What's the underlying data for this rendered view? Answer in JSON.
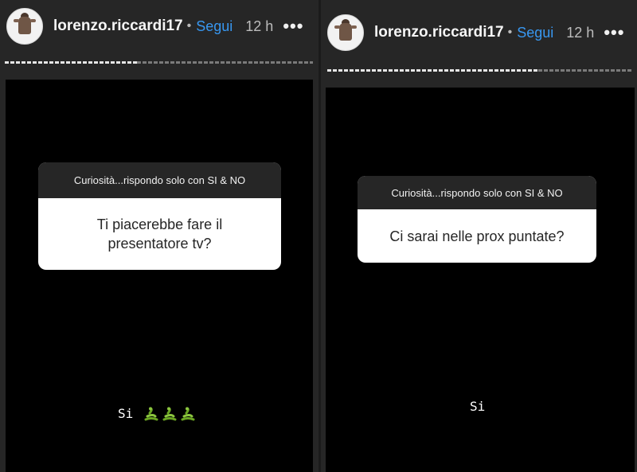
{
  "stories": [
    {
      "username": "lorenzo.riccardi17",
      "separator": "•",
      "follow_label": "Segui",
      "time": "12 h",
      "more_label": "•••",
      "progress": 0.43,
      "question_title": "Curiosità...rispondo solo con SI & NO",
      "question_text": "Ti piacerebbe fare il presentatore tv?",
      "answer": "Si",
      "answer_emoji": [
        "snake-icon",
        "snake-icon",
        "snake-icon"
      ]
    },
    {
      "username": "lorenzo.riccardi17",
      "separator": "•",
      "follow_label": "Segui",
      "time": "12 h",
      "more_label": "•••",
      "progress": 0.69,
      "question_title": "Curiosità...rispondo solo con SI & NO",
      "question_text": "Ci sarai nelle prox puntate?",
      "answer": "Si"
    }
  ],
  "colors": {
    "background": "#262626",
    "story_background": "#000000",
    "follow": "#3897f0",
    "emoji": "#7cb82f"
  }
}
